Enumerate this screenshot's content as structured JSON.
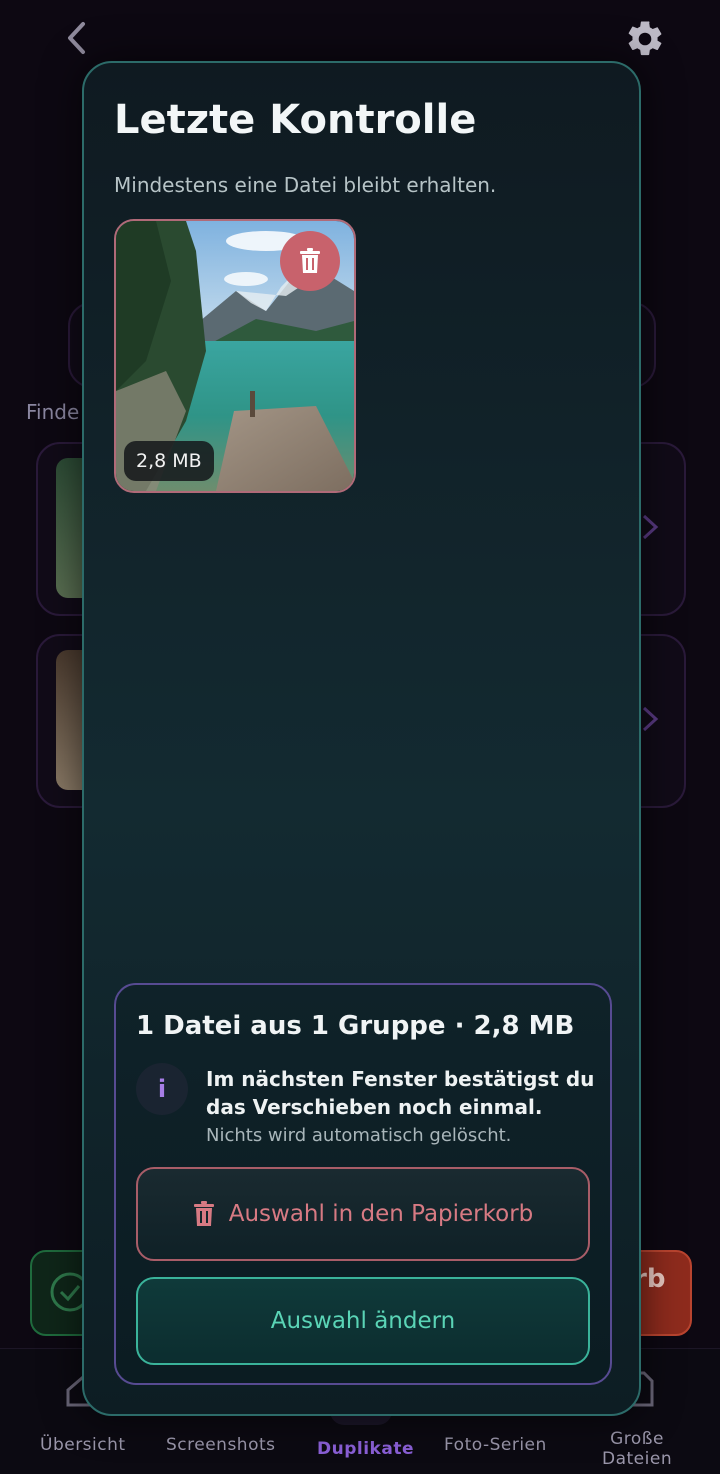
{
  "background": {
    "partial_label": "Finde",
    "action_right_partial": "rb"
  },
  "modal": {
    "title": "Letzte Kontrolle",
    "subtitle": "Mindestens eine Datei bleibt erhalten.",
    "photo": {
      "size_label": "2,8 MB",
      "delete_icon": "trash-icon"
    },
    "summary": {
      "title": "1 Datei aus 1 Gruppe · 2,8 MB",
      "info_icon_label": "i",
      "info_text": "Im nächsten Fenster bestätigst du das Verschieben noch einmal.",
      "info_subtext": "Nichts wird automatisch gelöscht.",
      "trash_button_label": "Auswahl in den Papierkorb",
      "change_button_label": "Auswahl ändern"
    }
  },
  "bottom_nav": {
    "items": [
      {
        "label": "Übersicht"
      },
      {
        "label": "Screenshots"
      },
      {
        "label": "Duplikate"
      },
      {
        "label": "Foto-Serien"
      },
      {
        "label_line1": "Große",
        "label_line2": "Dateien"
      }
    ],
    "active": "Duplikate"
  },
  "colors": {
    "accent_teal": "#5ad4b6",
    "accent_rose": "#d77a83",
    "accent_purple": "#8a5fd6"
  }
}
